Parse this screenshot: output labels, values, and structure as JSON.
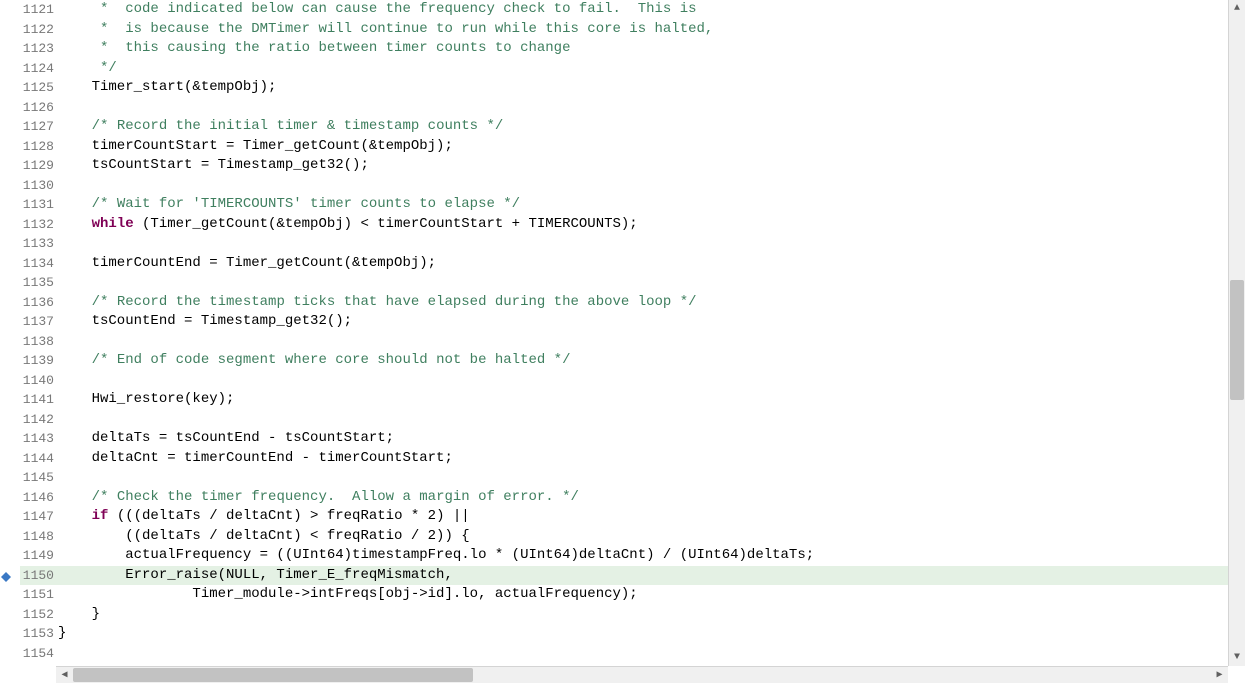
{
  "first_line_number": 1121,
  "highlighted_line": 1150,
  "breakpoint_line": 1150,
  "lines": [
    {
      "tokens": [
        {
          "t": "     *  code indicated below can cause the frequency check to fail.  This is",
          "c": "comment"
        }
      ]
    },
    {
      "tokens": [
        {
          "t": "     *  is because the DMTimer will continue to run while this core is halted,",
          "c": "comment"
        }
      ]
    },
    {
      "tokens": [
        {
          "t": "     *  this causing the ratio between timer counts to change",
          "c": "comment"
        }
      ]
    },
    {
      "tokens": [
        {
          "t": "     */",
          "c": "comment"
        }
      ]
    },
    {
      "tokens": [
        {
          "t": "    Timer_start(&tempObj);",
          "c": ""
        }
      ]
    },
    {
      "tokens": [
        {
          "t": "",
          "c": ""
        }
      ]
    },
    {
      "tokens": [
        {
          "t": "    ",
          "c": ""
        },
        {
          "t": "/* Record the initial timer & timestamp counts */",
          "c": "comment"
        }
      ]
    },
    {
      "tokens": [
        {
          "t": "    timerCountStart = Timer_getCount(&tempObj);",
          "c": ""
        }
      ]
    },
    {
      "tokens": [
        {
          "t": "    tsCountStart = Timestamp_get32();",
          "c": ""
        }
      ]
    },
    {
      "tokens": [
        {
          "t": "",
          "c": ""
        }
      ]
    },
    {
      "tokens": [
        {
          "t": "    ",
          "c": ""
        },
        {
          "t": "/* Wait for 'TIMERCOUNTS' timer counts to elapse */",
          "c": "comment"
        }
      ]
    },
    {
      "tokens": [
        {
          "t": "    ",
          "c": ""
        },
        {
          "t": "while",
          "c": "keyword"
        },
        {
          "t": " (Timer_getCount(&tempObj) < timerCountStart + TIMERCOUNTS);",
          "c": ""
        }
      ]
    },
    {
      "tokens": [
        {
          "t": "",
          "c": ""
        }
      ]
    },
    {
      "tokens": [
        {
          "t": "    timerCountEnd = Timer_getCount(&tempObj);",
          "c": ""
        }
      ]
    },
    {
      "tokens": [
        {
          "t": "",
          "c": ""
        }
      ]
    },
    {
      "tokens": [
        {
          "t": "    ",
          "c": ""
        },
        {
          "t": "/* Record the timestamp ticks that have elapsed during the above loop */",
          "c": "comment"
        }
      ]
    },
    {
      "tokens": [
        {
          "t": "    tsCountEnd = Timestamp_get32();",
          "c": ""
        }
      ]
    },
    {
      "tokens": [
        {
          "t": "",
          "c": ""
        }
      ]
    },
    {
      "tokens": [
        {
          "t": "    ",
          "c": ""
        },
        {
          "t": "/* End of code segment where core should not be halted */",
          "c": "comment"
        }
      ]
    },
    {
      "tokens": [
        {
          "t": "",
          "c": ""
        }
      ]
    },
    {
      "tokens": [
        {
          "t": "    Hwi_restore(key);",
          "c": ""
        }
      ]
    },
    {
      "tokens": [
        {
          "t": "",
          "c": ""
        }
      ]
    },
    {
      "tokens": [
        {
          "t": "    deltaTs = tsCountEnd - tsCountStart;",
          "c": ""
        }
      ]
    },
    {
      "tokens": [
        {
          "t": "    deltaCnt = timerCountEnd - timerCountStart;",
          "c": ""
        }
      ]
    },
    {
      "tokens": [
        {
          "t": "",
          "c": ""
        }
      ]
    },
    {
      "tokens": [
        {
          "t": "    ",
          "c": ""
        },
        {
          "t": "/* Check the timer frequency.  Allow a margin of error. */",
          "c": "comment"
        }
      ]
    },
    {
      "tokens": [
        {
          "t": "    ",
          "c": ""
        },
        {
          "t": "if",
          "c": "keyword"
        },
        {
          "t": " (((deltaTs / deltaCnt) > freqRatio * 2) ||",
          "c": ""
        }
      ]
    },
    {
      "tokens": [
        {
          "t": "        ((deltaTs / deltaCnt) < freqRatio / 2)) {",
          "c": ""
        }
      ]
    },
    {
      "tokens": [
        {
          "t": "        actualFrequency = ((UInt64)timestampFreq.lo * (UInt64)deltaCnt) / (UInt64)deltaTs;",
          "c": ""
        }
      ]
    },
    {
      "tokens": [
        {
          "t": "        Error_raise(NULL, Timer_E_freqMismatch,",
          "c": ""
        }
      ]
    },
    {
      "tokens": [
        {
          "t": "                Timer_module->intFreqs[obj->id].lo, actualFrequency);",
          "c": ""
        }
      ]
    },
    {
      "tokens": [
        {
          "t": "    }",
          "c": ""
        }
      ]
    },
    {
      "tokens": [
        {
          "t": "}",
          "c": ""
        }
      ]
    },
    {
      "tokens": [
        {
          "t": "",
          "c": ""
        }
      ]
    }
  ]
}
